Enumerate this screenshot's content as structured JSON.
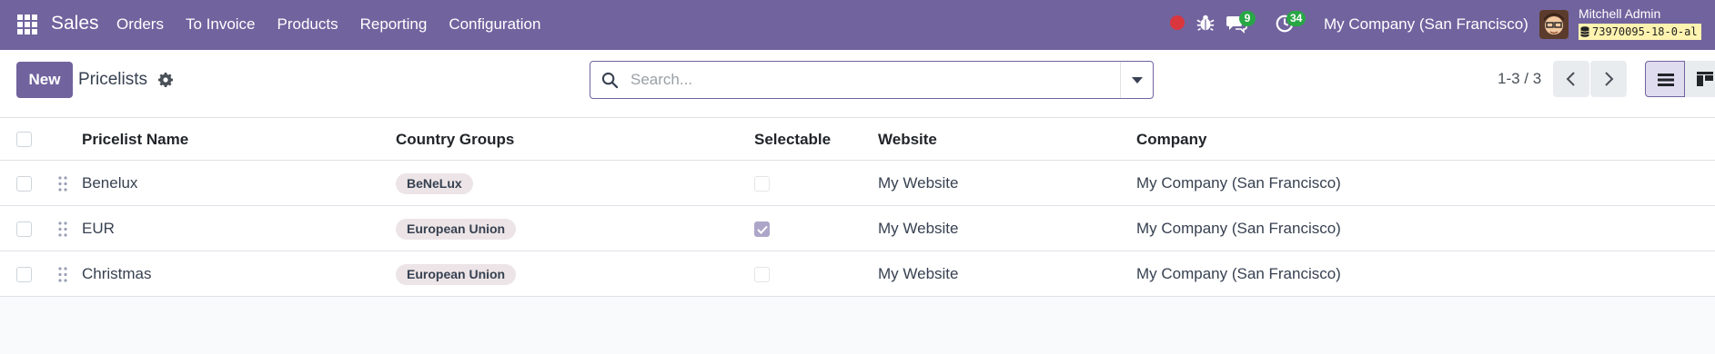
{
  "navbar": {
    "app_name": "Sales",
    "menu": [
      "Orders",
      "To Invoice",
      "Products",
      "Reporting",
      "Configuration"
    ],
    "chat_count": "9",
    "activity_count": "34",
    "company": "My Company (San Francisco)",
    "user_name": "Mitchell Admin",
    "database": "73970095-18-0-al"
  },
  "control_panel": {
    "new_button": "New",
    "title": "Pricelists",
    "search_placeholder": "Search...",
    "pager": "1-3 / 3"
  },
  "table": {
    "headers": {
      "name": "Pricelist Name",
      "groups": "Country Groups",
      "selectable": "Selectable",
      "website": "Website",
      "company": "Company"
    },
    "rows": [
      {
        "name": "Benelux",
        "group": "BeNeLux",
        "selectable": false,
        "website": "My Website",
        "company": "My Company (San Francisco)"
      },
      {
        "name": "EUR",
        "group": "European Union",
        "selectable": true,
        "website": "My Website",
        "company": "My Company (San Francisco)"
      },
      {
        "name": "Christmas",
        "group": "European Union",
        "selectable": false,
        "website": "My Website",
        "company": "My Company (San Francisco)"
      }
    ]
  },
  "colors": {
    "brand": "#71639e",
    "badge": "#28a745",
    "recording": "#d9363e",
    "tag_bg": "#ece4e6"
  },
  "icons": [
    "apps-grid-icon",
    "bug-icon",
    "chat-icon",
    "activity-clock-icon",
    "gear-icon",
    "search-icon",
    "caret-down-icon",
    "chevron-left-icon",
    "chevron-right-icon",
    "list-view-icon",
    "kanban-view-icon",
    "drag-handle-icon",
    "database-icon"
  ]
}
